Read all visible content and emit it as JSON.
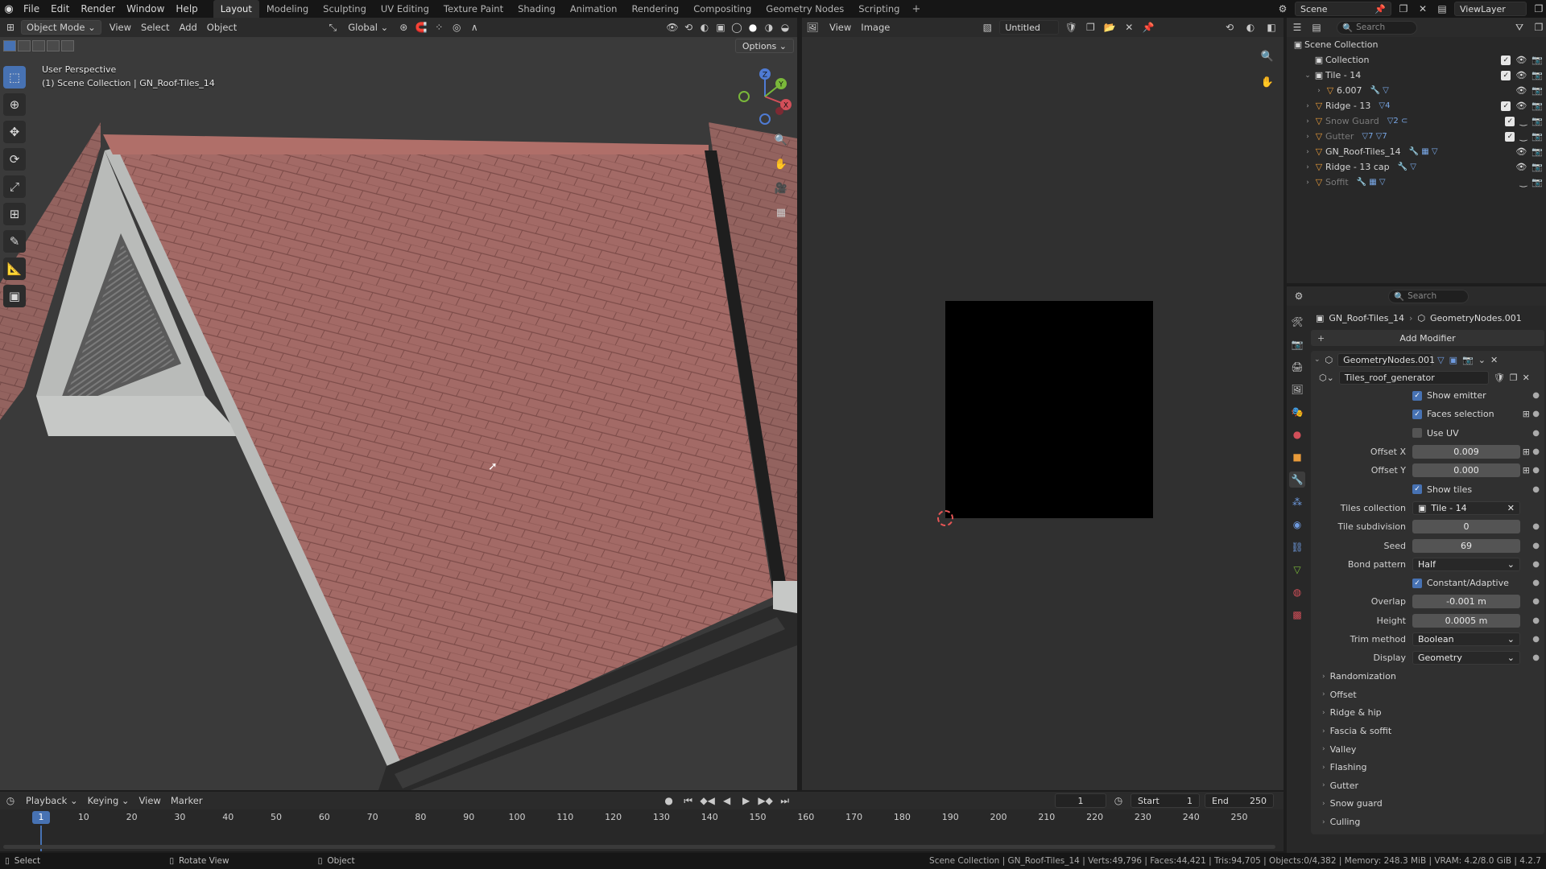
{
  "menu": {
    "items": [
      "File",
      "Edit",
      "Render",
      "Window",
      "Help"
    ],
    "workspaces": [
      "Layout",
      "Modeling",
      "Sculpting",
      "UV Editing",
      "Texture Paint",
      "Shading",
      "Animation",
      "Rendering",
      "Compositing",
      "Geometry Nodes",
      "Scripting"
    ],
    "active_workspace": "Layout",
    "scene": "Scene",
    "view_layer": "ViewLayer"
  },
  "viewport": {
    "mode": "Object Mode",
    "menus": [
      "View",
      "Select",
      "Add",
      "Object"
    ],
    "transform_orientation": "Global",
    "options_label": "Options",
    "info_line1": "User Perspective",
    "info_line2": "(1) Scene Collection | GN_Roof-Tiles_14",
    "gizmo_axes": {
      "x": "X",
      "y": "Y",
      "z": "Z"
    }
  },
  "image_editor": {
    "menus": [
      "View",
      "Image"
    ],
    "image_name": "Untitled"
  },
  "outliner": {
    "search_placeholder": "Search",
    "root": "Scene Collection",
    "rows": [
      {
        "name": "Collection",
        "indent": 1,
        "expand": "",
        "dim": false,
        "badges": ""
      },
      {
        "name": "Tile - 14",
        "indent": 1,
        "expand": "⌄",
        "dim": false,
        "badges": ""
      },
      {
        "name": "6.007",
        "indent": 2,
        "expand": "›",
        "dim": false,
        "badges": "🔧 ▽"
      },
      {
        "name": "Ridge - 13",
        "indent": 1,
        "expand": "›",
        "dim": false,
        "badges": "▽4"
      },
      {
        "name": "Snow Guard",
        "indent": 1,
        "expand": "›",
        "dim": true,
        "badges": "▽2 ⊂"
      },
      {
        "name": "Gutter",
        "indent": 1,
        "expand": "›",
        "dim": true,
        "badges": "▽7 ▽7"
      },
      {
        "name": "GN_Roof-Tiles_14",
        "indent": 1,
        "expand": "›",
        "dim": false,
        "badges": "🔧 ▦ ▽"
      },
      {
        "name": "Ridge - 13 cap",
        "indent": 1,
        "expand": "›",
        "dim": false,
        "badges": "🔧 ▽"
      },
      {
        "name": "Soffit",
        "indent": 1,
        "expand": "›",
        "dim": true,
        "badges": "🔧 ▦ ▽"
      }
    ]
  },
  "properties": {
    "search_placeholder": "Search",
    "breadcrumb_object": "GN_Roof-Tiles_14",
    "breadcrumb_modifier": "GeometryNodes.001",
    "add_modifier": "Add Modifier",
    "modifier_name": "GeometryNodes.001",
    "node_group": "Tiles_roof_generator",
    "checks": [
      {
        "label": "Show emitter",
        "checked": true
      },
      {
        "label": "Faces selection",
        "checked": true
      },
      {
        "label": "Use UV",
        "checked": false
      }
    ],
    "offset_x_label": "Offset X",
    "offset_x": "0.009",
    "offset_y_label": "Offset Y",
    "offset_y": "0.000",
    "show_tiles": "Show tiles",
    "tiles_collection_label": "Tiles collection",
    "tiles_collection": "Tile - 14",
    "tile_subdivision_label": "Tile subdivision",
    "tile_subdivision": "0",
    "seed_label": "Seed",
    "seed": "69",
    "bond_pattern_label": "Bond pattern",
    "bond_pattern": "Half",
    "constant_adaptive": "Constant/Adaptive",
    "overlap_label": "Overlap",
    "overlap": "-0.001 m",
    "height_label": "Height",
    "height": "0.0005 m",
    "trim_method_label": "Trim method",
    "trim_method": "Boolean",
    "display_label": "Display",
    "display": "Geometry",
    "panels": [
      "Randomization",
      "Offset",
      "Ridge & hip",
      "Fascia & soffit",
      "Valley",
      "Flashing",
      "Gutter",
      "Snow guard",
      "Culling"
    ]
  },
  "timeline": {
    "menus": [
      "Playback",
      "Keying",
      "View",
      "Marker"
    ],
    "current_frame": "1",
    "start_label": "Start",
    "start": "1",
    "end_label": "End",
    "end": "250",
    "ticks": [
      "10",
      "20",
      "30",
      "40",
      "50",
      "60",
      "70",
      "80",
      "90",
      "100",
      "110",
      "120",
      "130",
      "140",
      "150",
      "160",
      "170",
      "180",
      "190",
      "200",
      "210",
      "220",
      "230",
      "240",
      "250"
    ],
    "cursor_frame": "1"
  },
  "status": {
    "select": "Select",
    "rotate": "Rotate View",
    "object": "Object",
    "stats": "Scene Collection | GN_Roof-Tiles_14 | Verts:49,796 | Faces:44,421 | Tris:94,705 | Objects:0/4,382 | Memory: 248.3 MiB | VRAM: 4.2/8.0 GiB | 4.2.7"
  },
  "colors": {
    "accent": "#4772b3",
    "roof_tile": "#a36a66",
    "wall": "#b9bbb9",
    "gutter": "#2a2a2a",
    "viewport_bg": "#3a3a3a"
  }
}
